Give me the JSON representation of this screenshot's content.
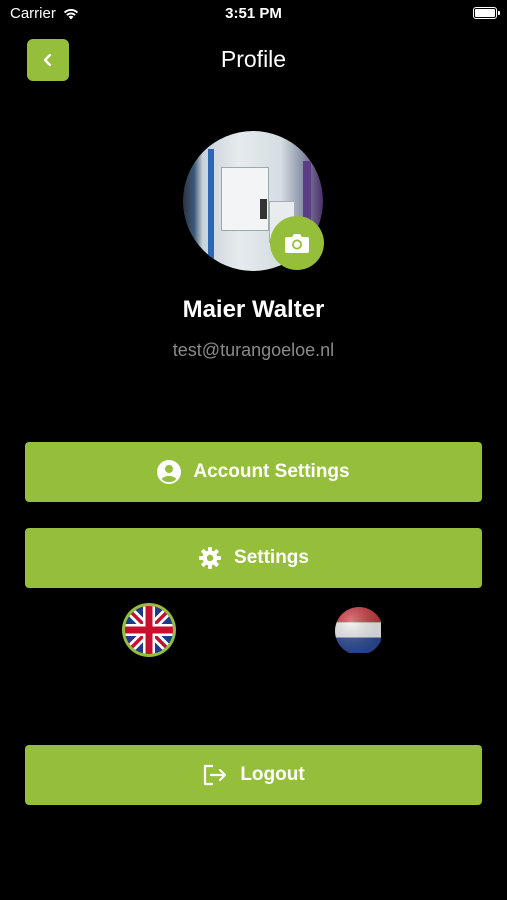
{
  "status_bar": {
    "carrier": "Carrier",
    "time": "3:51 PM"
  },
  "header": {
    "title": "Profile"
  },
  "profile": {
    "name": "Maier Walter",
    "email": "test@turangoeloe.nl"
  },
  "menu": {
    "account_settings": "Account Settings",
    "settings": "Settings",
    "logout": "Logout"
  },
  "languages": [
    {
      "name": "English",
      "icon": "uk-flag",
      "selected": true
    },
    {
      "name": "Dutch",
      "icon": "nl-flag",
      "selected": false
    }
  ],
  "colors": {
    "accent": "#95bf3a",
    "background": "#000000",
    "email_text": "#8a8a8a"
  }
}
